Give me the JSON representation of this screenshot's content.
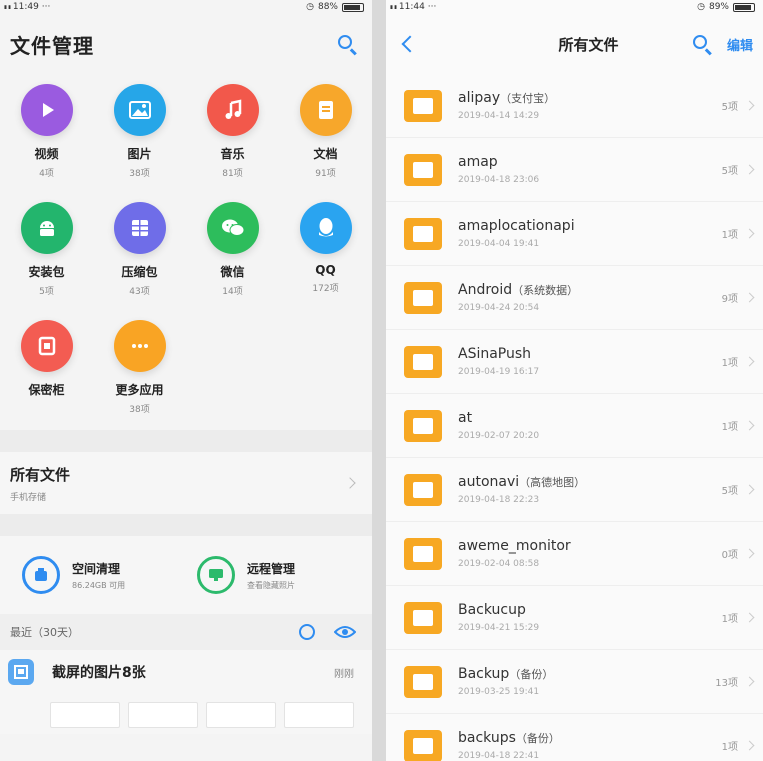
{
  "left": {
    "status": {
      "signal": "ᵢᵢ ᵢᵢ",
      "time": "11:49",
      "battery": "88%",
      "battery_level": 0.88
    },
    "title": "文件管理",
    "categories": [
      {
        "name": "视频",
        "count": "4项",
        "color": "#9a5be0",
        "icon": "play-icon"
      },
      {
        "name": "图片",
        "count": "38项",
        "color": "#26a6e8",
        "icon": "image-icon"
      },
      {
        "name": "音乐",
        "count": "81项",
        "color": "#f2584b",
        "icon": "music-note-icon"
      },
      {
        "name": "文档",
        "count": "91项",
        "color": "#f7a72b",
        "icon": "document-icon"
      },
      {
        "name": "安装包",
        "count": "5项",
        "color": "#23b56d",
        "icon": "android-icon"
      },
      {
        "name": "压缩包",
        "count": "43项",
        "color": "#6f6de8",
        "icon": "archive-icon"
      },
      {
        "name": "微信",
        "count": "14项",
        "color": "#2dbd5c",
        "icon": "wechat-icon"
      },
      {
        "name": "QQ",
        "count": "172项",
        "color": "#2aa4f0",
        "icon": "qq-icon"
      },
      {
        "name": "保密柜",
        "count": "",
        "color": "#f35c52",
        "icon": "safe-icon"
      },
      {
        "name": "更多应用",
        "count": "38项",
        "color": "#f9a424",
        "icon": "more-icon"
      }
    ],
    "all_files": {
      "title": "所有文件",
      "subtitle": "手机存储"
    },
    "tools": [
      {
        "title": "空间清理",
        "subtitle": "86.24GB 可用",
        "color": "#2f8cf0"
      },
      {
        "title": "远程管理",
        "subtitle": "查看隐藏照片",
        "color": "#2cba6c"
      }
    ],
    "recent": {
      "label": "最近（30天）"
    },
    "recent_item": {
      "title": "截屏的图片8张",
      "time": "刚刚"
    }
  },
  "right": {
    "status": {
      "signal": "ᵢᵢ ᵢᵢ",
      "time": "11:44",
      "battery": "89%",
      "battery_level": 0.89
    },
    "title": "所有文件",
    "edit_label": "编辑",
    "files": [
      {
        "name": "alipay",
        "alias": "（支付宝）",
        "date": "2019-04-14 14:29",
        "count": "5项"
      },
      {
        "name": "amap",
        "alias": "",
        "date": "2019-04-18 23:06",
        "count": "5项"
      },
      {
        "name": "amaplocationapi",
        "alias": "",
        "date": "2019-04-04 19:41",
        "count": "1项"
      },
      {
        "name": "Android",
        "alias": "（系统数据）",
        "date": "2019-04-24 20:54",
        "count": "9项"
      },
      {
        "name": "ASinaPush",
        "alias": "",
        "date": "2019-04-19 16:17",
        "count": "1项"
      },
      {
        "name": "at",
        "alias": "",
        "date": "2019-02-07 20:20",
        "count": "1项"
      },
      {
        "name": "autonavi",
        "alias": "（高德地图）",
        "date": "2019-04-18 22:23",
        "count": "5项"
      },
      {
        "name": "aweme_monitor",
        "alias": "",
        "date": "2019-02-04 08:58",
        "count": "0项"
      },
      {
        "name": "Backucup",
        "alias": "",
        "date": "2019-04-21 15:29",
        "count": "1项"
      },
      {
        "name": "Backup",
        "alias": "（备份）",
        "date": "2019-03-25 19:41",
        "count": "13项"
      },
      {
        "name": "backups",
        "alias": "（备份）",
        "date": "2019-04-18 22:41",
        "count": "1项"
      }
    ]
  }
}
